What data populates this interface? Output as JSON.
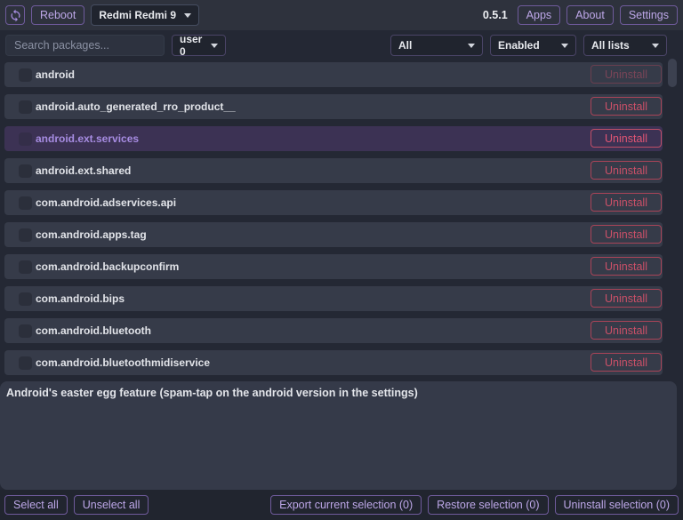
{
  "topbar": {
    "reboot_label": "Reboot",
    "device_dropdown": {
      "selected": "Redmi Redmi 9"
    },
    "version": "0.5.1",
    "nav_buttons": [
      {
        "label": "Apps"
      },
      {
        "label": "About"
      },
      {
        "label": "Settings"
      }
    ]
  },
  "filterbar": {
    "search_placeholder": "Search packages...",
    "user_dropdown": {
      "selected": "user 0"
    },
    "type_dropdown": {
      "selected": "All"
    },
    "state_dropdown": {
      "selected": "Enabled"
    },
    "list_dropdown": {
      "selected": "All lists"
    }
  },
  "package_list": {
    "uninstall_label": "Uninstall",
    "rows": [
      {
        "name": "android",
        "checked": false,
        "selected": false,
        "uninstall_disabled": true
      },
      {
        "name": "android.auto_generated_rro_product__",
        "checked": false,
        "selected": false,
        "uninstall_disabled": false
      },
      {
        "name": "android.ext.services",
        "checked": false,
        "selected": true,
        "uninstall_disabled": false
      },
      {
        "name": "android.ext.shared",
        "checked": false,
        "selected": false,
        "uninstall_disabled": false
      },
      {
        "name": "com.android.adservices.api",
        "checked": false,
        "selected": false,
        "uninstall_disabled": false
      },
      {
        "name": "com.android.apps.tag",
        "checked": false,
        "selected": false,
        "uninstall_disabled": false
      },
      {
        "name": "com.android.backupconfirm",
        "checked": false,
        "selected": false,
        "uninstall_disabled": false
      },
      {
        "name": "com.android.bips",
        "checked": false,
        "selected": false,
        "uninstall_disabled": false
      },
      {
        "name": "com.android.bluetooth",
        "checked": false,
        "selected": false,
        "uninstall_disabled": false
      },
      {
        "name": "com.android.bluetoothmidiservice",
        "checked": false,
        "selected": false,
        "uninstall_disabled": false
      }
    ]
  },
  "description_panel": {
    "text": "Android's easter egg feature (spam-tap on the android version in the settings)"
  },
  "footer": {
    "select_all_label": "Select all",
    "unselect_all_label": "Unselect all",
    "export_label": "Export current selection (0)",
    "restore_label": "Restore selection (0)",
    "uninstall_selection_label": "Uninstall selection (0)"
  },
  "colors": {
    "accent_purple": "#bda7e8",
    "accent_purple_border": "#6f5b9c",
    "danger_red": "#cb5068",
    "selected_row_bg": "#3c3254",
    "selected_row_text": "#a78ce2",
    "topbar_bg": "#2e323d",
    "page_bg": "#242834",
    "row_bg": "#363b49"
  }
}
